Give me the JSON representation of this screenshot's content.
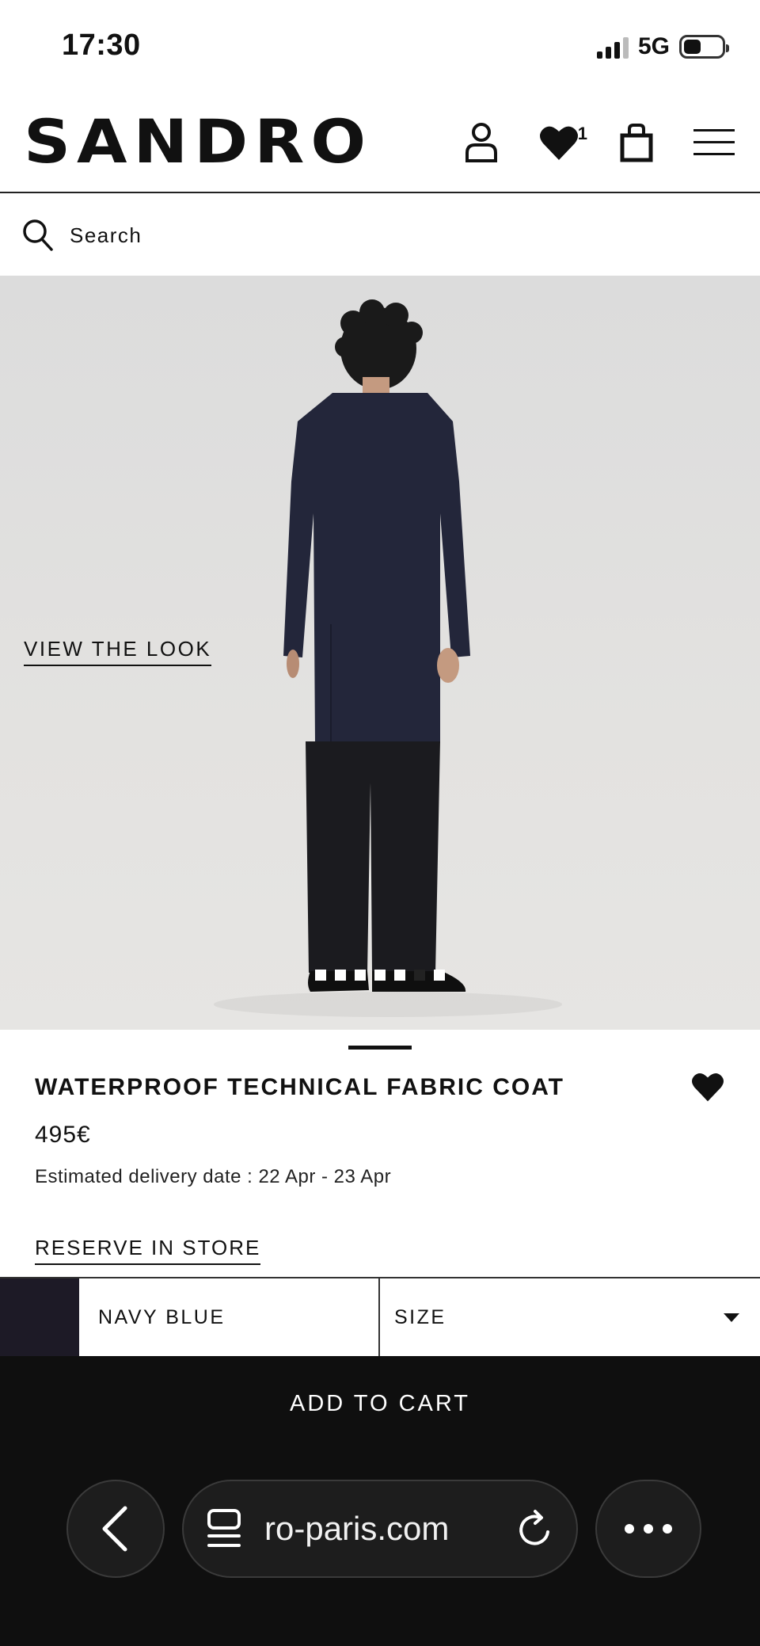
{
  "status_bar": {
    "time": "17:30",
    "network": "5G"
  },
  "header": {
    "logo": "SANDRO",
    "wishlist_count": "1",
    "icons": [
      "account-icon",
      "heart-icon",
      "shopping-bag-icon",
      "menu-icon"
    ]
  },
  "search": {
    "label": "Search"
  },
  "gallery": {
    "view_look": "VIEW THE LOOK",
    "image_count": 7,
    "active_index": 5
  },
  "product": {
    "title": "WATERPROOF TECHNICAL FABRIC COAT",
    "price": "495€",
    "delivery": "Estimated delivery date : 22 Apr - 23 Apr",
    "reserve": "RESERVE IN STORE",
    "color_name": "NAVY BLUE",
    "color_hex": "#1d1a26",
    "size_label": "SIZE"
  },
  "cart": {
    "add_label": "ADD TO CART"
  },
  "browser": {
    "url": "ro-paris.com"
  }
}
